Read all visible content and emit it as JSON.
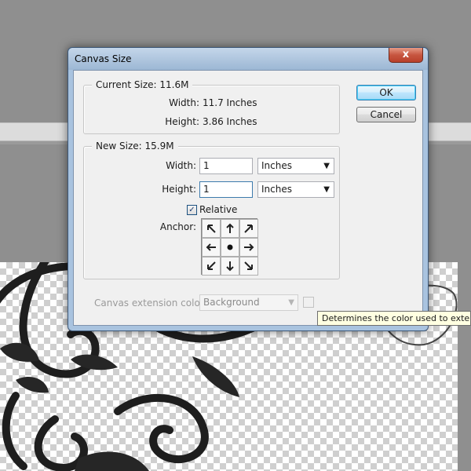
{
  "dialog": {
    "title": "Canvas Size",
    "close_label": "x",
    "current_size": {
      "legend": "Current Size: 11.6M",
      "width_label": "Width:",
      "width_value": "11.7 Inches",
      "height_label": "Height:",
      "height_value": "3.86 Inches"
    },
    "new_size": {
      "legend": "New Size: 15.9M",
      "width_label": "Width:",
      "width_value": "1",
      "width_unit": "Inches",
      "height_label": "Height:",
      "height_value": "1",
      "height_unit": "Inches",
      "relative_label": "Relative",
      "relative_checked": true,
      "anchor_label": "Anchor:",
      "anchor_icons": [
        "arrow-up-left-icon",
        "arrow-up-icon",
        "arrow-up-right-icon",
        "arrow-left-icon",
        "anchor-center-dot-icon",
        "arrow-right-icon",
        "arrow-down-left-icon",
        "arrow-down-icon",
        "arrow-down-right-icon"
      ]
    },
    "extension": {
      "label": "Canvas extension color:",
      "value": "Background"
    },
    "ok_label": "OK",
    "cancel_label": "Cancel"
  },
  "tooltip": {
    "text": "Determines the color used to extend"
  },
  "colors": {
    "titlebar": "#a9c3df",
    "close_button": "#c75640",
    "dialog_body": "#f0f0f0",
    "tooltip_bg": "#ffffe1"
  }
}
